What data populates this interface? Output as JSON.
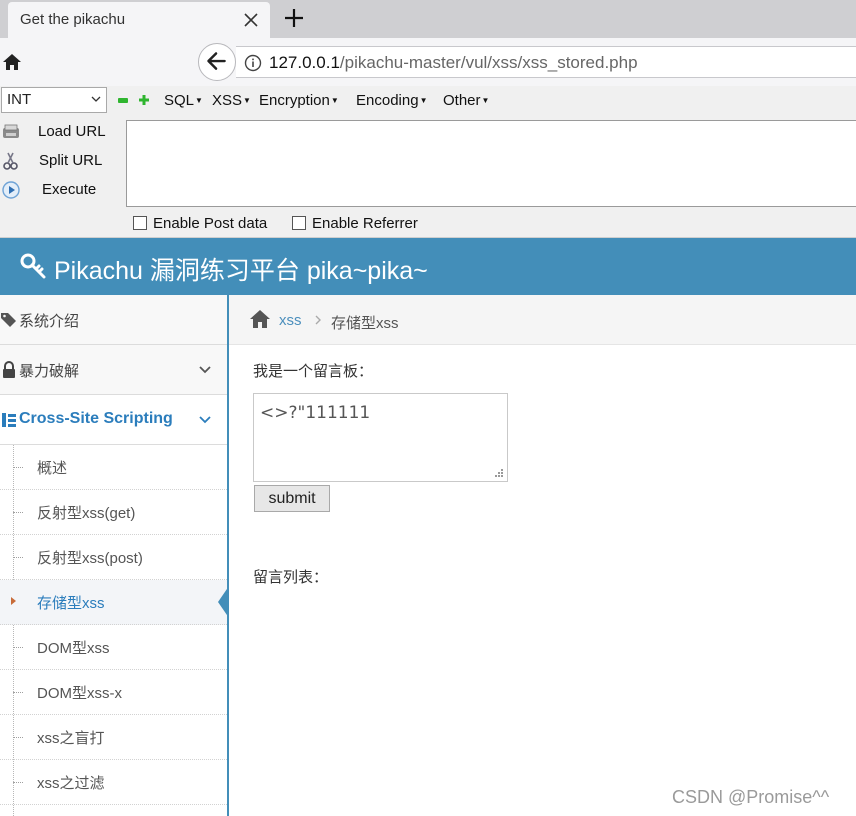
{
  "browser": {
    "tab_title": "Get the pikachu",
    "url_host": "127.0.0.1",
    "url_path": "/pikachu-master/vul/xss/xss_stored.php"
  },
  "hackbar": {
    "select_value": "INT",
    "menus": [
      "SQL",
      "XSS",
      "Encryption",
      "Encoding",
      "Other"
    ],
    "actions": {
      "load_url": "Load URL",
      "split_url": "Split URL",
      "execute": "Execute"
    },
    "checkboxes": {
      "post": "Enable Post data",
      "referrer": "Enable Referrer"
    }
  },
  "header": {
    "title": "Pikachu 漏洞练习平台 pika~pika~"
  },
  "sidebar": {
    "items": [
      {
        "label": "系统介绍"
      },
      {
        "label": "暴力破解"
      },
      {
        "label": "Cross-Site Scripting"
      }
    ],
    "subitems": [
      {
        "label": "概述"
      },
      {
        "label": "反射型xss(get)"
      },
      {
        "label": "反射型xss(post)"
      },
      {
        "label": "存储型xss"
      },
      {
        "label": "DOM型xss"
      },
      {
        "label": "DOM型xss-x"
      },
      {
        "label": "xss之盲打"
      },
      {
        "label": "xss之过滤"
      }
    ]
  },
  "main": {
    "breadcrumb_link": "xss",
    "breadcrumb_current": "存储型xss",
    "board_label": "我是一个留言板：",
    "message_value": "<>?\"111111",
    "submit_label": "submit",
    "list_label": "留言列表："
  },
  "watermark": "CSDN @Promise^^",
  "colors": {
    "header_bg": "#438eb9",
    "link": "#2b7dbc"
  }
}
